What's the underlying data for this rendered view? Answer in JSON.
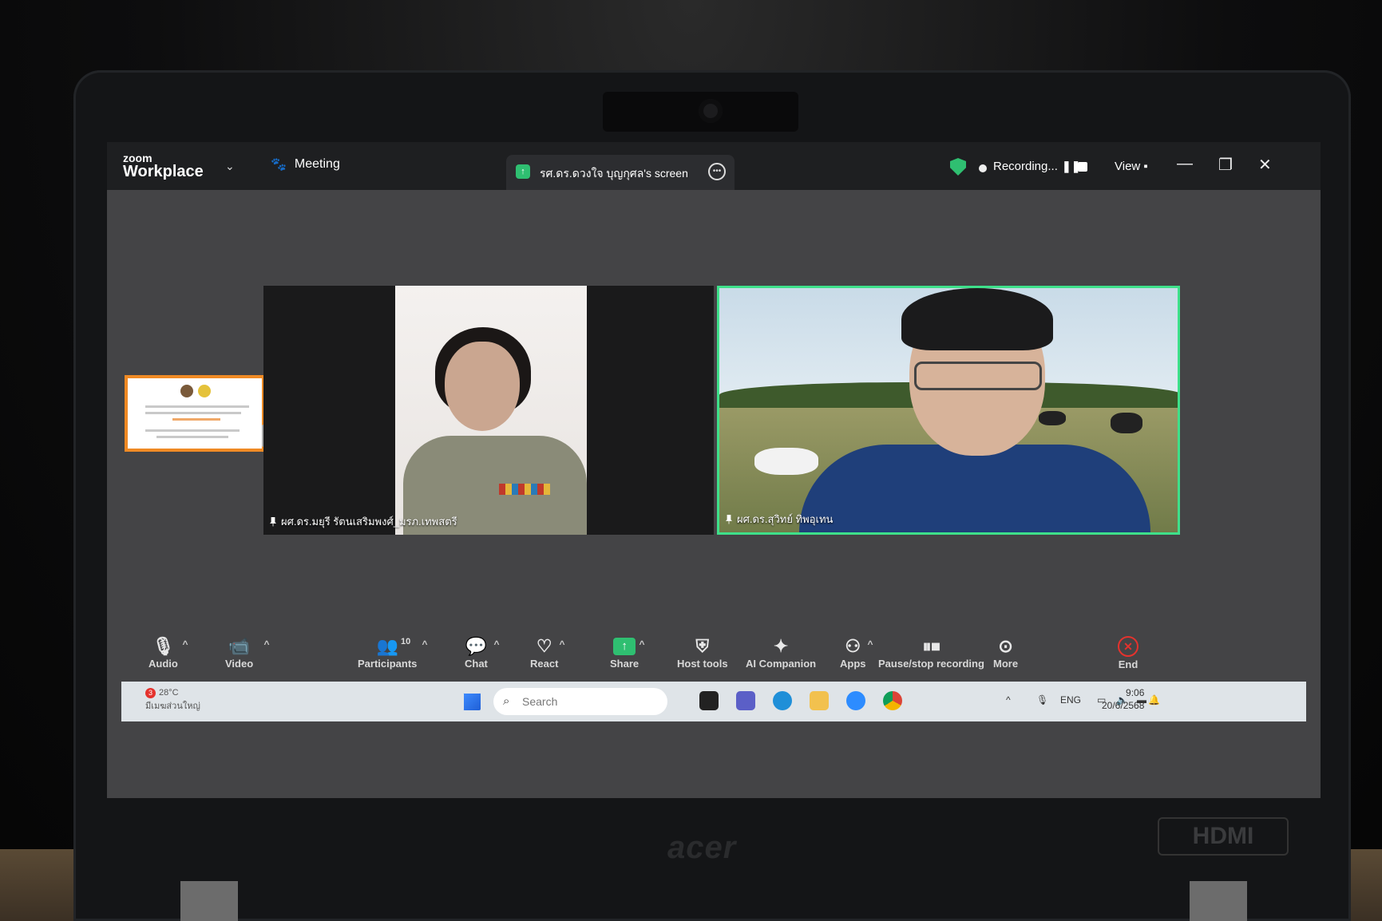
{
  "titlebar": {
    "logo_small": "zoom",
    "logo_big": "Workplace",
    "meeting_label": "Meeting",
    "share_tab_label": "รศ.ดร.ดวงใจ บุญกุศล's screen",
    "recording_label": "Recording...",
    "view_label": "View"
  },
  "tiles": {
    "left_name": "ผศ.ดร.มยุรี รัตนเสริมพงศ์_มรภ.เทพสตรี",
    "right_name": "ผศ.ดร.สุวิทย์ ทิพอุเทน"
  },
  "toolbar": {
    "audio": "Audio",
    "video": "Video",
    "participants": "Participants",
    "participants_count": "10",
    "chat": "Chat",
    "react": "React",
    "share": "Share",
    "host_tools": "Host tools",
    "ai_companion": "AI Companion",
    "apps": "Apps",
    "pause_stop": "Pause/stop recording",
    "more": "More",
    "end": "End"
  },
  "taskbar": {
    "weather_badge": "3",
    "weather_temp": "28°C",
    "weather_desc": "มีเมฆส่วนใหญ่",
    "search_placeholder": "Search",
    "lang": "ENG",
    "time": "9:06",
    "date": "20/6/2568"
  },
  "hardware": {
    "brand": "acer",
    "port_label": "HDMI"
  },
  "colors": {
    "accent_green": "#2fbf71",
    "active_speaker_border": "#3ee08a",
    "end_red": "#e5322d",
    "thumbnail_border": "#f08a24"
  },
  "icons": [
    "zoom-logo",
    "chevron-down-icon",
    "paw-icon",
    "screen-share-indicator-icon",
    "ellipsis-icon",
    "shield-check-icon",
    "record-dot-icon",
    "pause-icon",
    "stop-icon",
    "view-icon",
    "minimize-icon",
    "restore-icon",
    "close-icon",
    "microphone-icon",
    "video-camera-icon",
    "participants-icon",
    "chat-icon",
    "heart-icon",
    "share-arrow-icon",
    "host-shield-icon",
    "sparkle-icon",
    "apps-icon",
    "pause-stop-icon",
    "more-icon",
    "end-icon",
    "windows-start-icon",
    "search-icon"
  ]
}
